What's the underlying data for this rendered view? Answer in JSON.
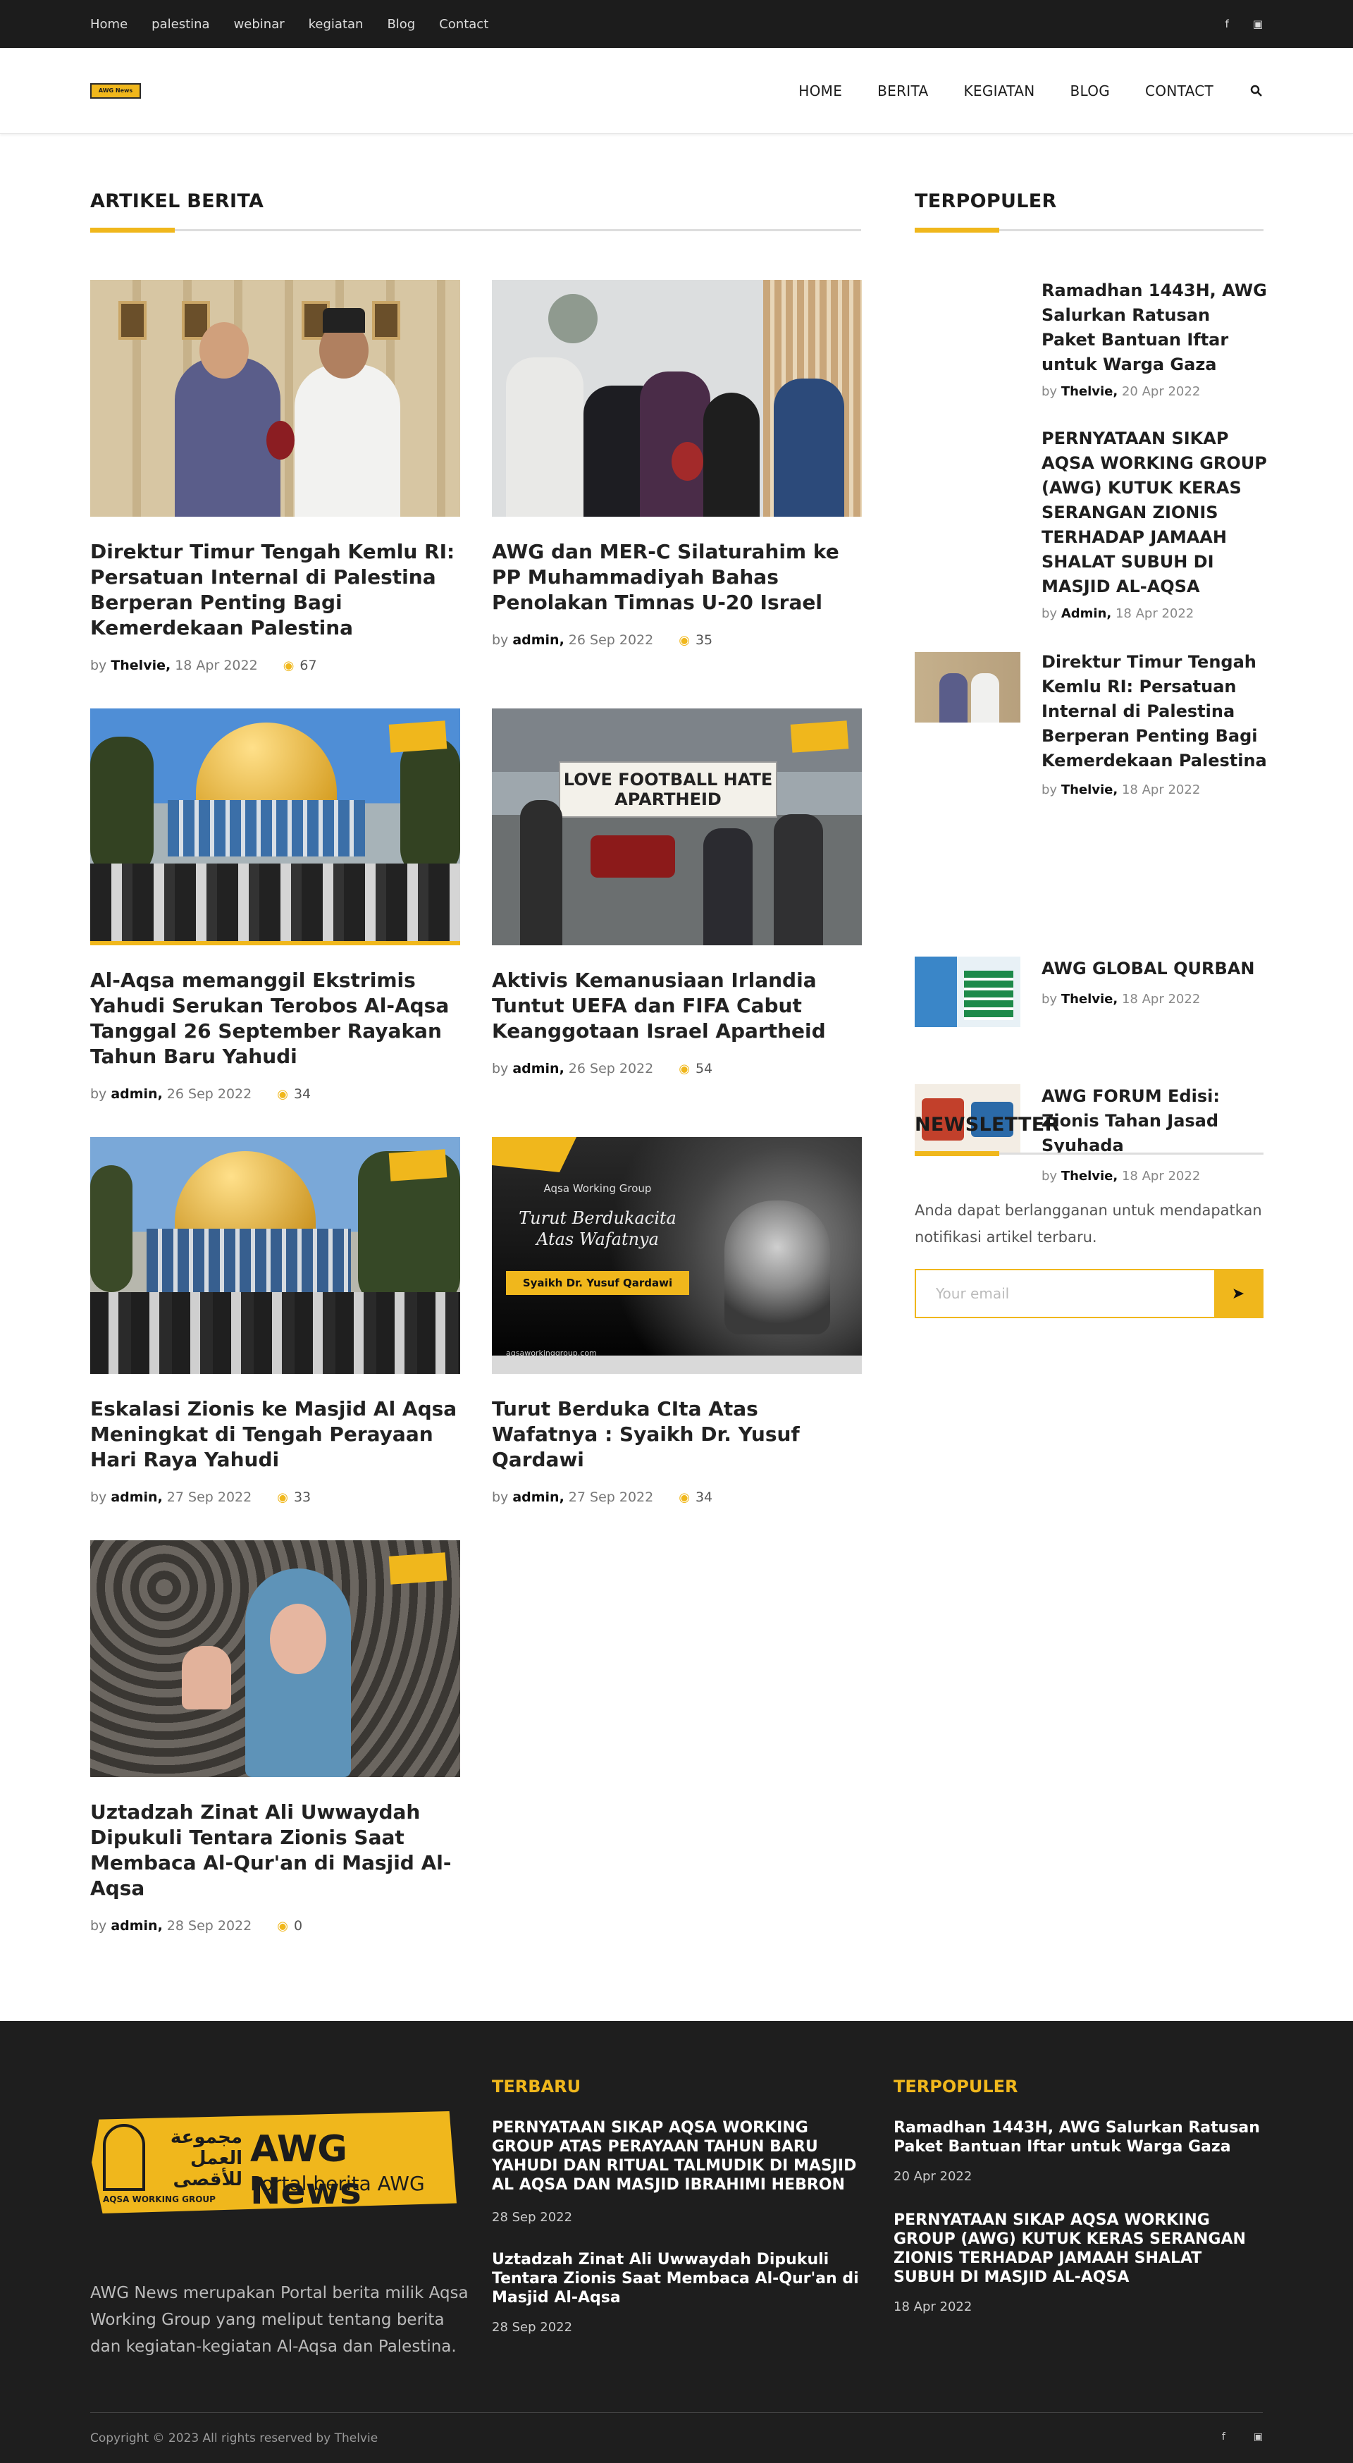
{
  "topbar": {
    "links": [
      "Home",
      "palestina",
      "webinar",
      "kegiatan",
      "Blog",
      "Contact"
    ],
    "social": [
      "facebook-icon",
      "instagram-icon"
    ]
  },
  "header": {
    "logo_text": "AWG News",
    "nav": [
      "HOME",
      "BERITA",
      "KEGIATAN",
      "BLOG",
      "CONTACT"
    ],
    "search_icon": "search-icon"
  },
  "main": {
    "title": "ARTIKEL BERITA",
    "by": "by",
    "articles": [
      {
        "title": "Direktur Timur Tengah Kemlu RI: Persatuan Internal di Palestina Berperan Penting Bagi Kemerdekaan Palestina",
        "author": "Thelvie,",
        "date": "18 Apr 2022",
        "views": "67"
      },
      {
        "title": "AWG dan MER-C Silaturahim ke PP Muhammadiyah Bahas Penolakan Timnas U-20 Israel",
        "author": "admin,",
        "date": "26 Sep 2022",
        "views": "35"
      },
      {
        "title": "Al-Aqsa memanggil Ekstrimis Yahudi Serukan Terobos Al-Aqsa Tanggal 26 September Rayakan Tahun Baru Yahudi",
        "author": "admin,",
        "date": "26 Sep 2022",
        "views": "34"
      },
      {
        "title": "Aktivis Kemanusiaan Irlandia Tuntut UEFA dan FIFA Cabut Keanggotaan Israel Apartheid",
        "author": "admin,",
        "date": "26 Sep 2022",
        "views": "54",
        "photo_text": "LOVE FOOTBALL HATE APARTHEID"
      },
      {
        "title": "Eskalasi Zionis ke Masjid Al Aqsa Meningkat di Tengah Perayaan Hari Raya Yahudi",
        "author": "admin,",
        "date": "27 Sep 2022",
        "views": "33"
      },
      {
        "title": "Turut Berduka CIta Atas Wafatnya : Syaikh Dr. Yusuf Qardawi",
        "author": "admin,",
        "date": "27 Sep 2022",
        "views": "34",
        "poster": {
          "org": "Aqsa Working Group",
          "headline": "Turut Berdukacita Atas Wafatnya",
          "name": "Syaikh Dr. Yusuf Qardawi",
          "site": "aqsaworkinggroup.com"
        }
      },
      {
        "title": "Uztadzah Zinat Ali Uwwaydah Dipukuli Tentara Zionis Saat Membaca Al-Qur'an di Masjid Al-Aqsa",
        "author": "admin,",
        "date": "28 Sep 2022",
        "views": "0"
      }
    ]
  },
  "sidebar": {
    "title": "TERPOPULER",
    "items": [
      {
        "title": "Ramadhan 1443H, AWG Salurkan Ratusan Paket Bantuan Iftar untuk Warga Gaza",
        "author": "Thelvie,",
        "date": "20 Apr 2022"
      },
      {
        "title": "PERNYATAAN SIKAP AQSA WORKING GROUP (AWG) KUTUK KERAS SERANGAN ZIONIS TERHADAP JAMAAH SHALAT SUBUH DI MASJID AL-AQSA",
        "author": "Admin,",
        "date": "18 Apr 2022"
      },
      {
        "title": "Direktur Timur Tengah Kemlu RI: Persatuan Internal di Palestina Berperan Penting Bagi Kemerdekaan Palestina",
        "author": "Thelvie,",
        "date": "18 Apr 2022"
      },
      {
        "title": "AWG GLOBAL QURBAN",
        "author": "Thelvie,",
        "date": "18 Apr 2022"
      },
      {
        "title": "AWG FORUM Edisi: Zionis Tahan Jasad Syuhada",
        "author": "Thelvie,",
        "date": "18 Apr 2022"
      }
    ],
    "newsletter": {
      "title": "NEWSLETTER",
      "text": "Anda dapat berlangganan untuk mendapatkan notifikasi artikel terbaru.",
      "placeholder": "Your email"
    }
  },
  "footer": {
    "logo": {
      "arabic": "مجموعة العمل للأقصى",
      "name": "AWG News",
      "tagline": "Portal berita AWG",
      "org": "AQSA WORKING GROUP"
    },
    "description": "AWG News merupakan Portal berita milik Aqsa Working Group yang meliput tentang berita dan kegiatan-kegiatan Al-Aqsa dan Palestina.",
    "latest_title": "TERBARU",
    "latest": [
      {
        "title": "PERNYATAAN SIKAP AQSA WORKING GROUP ATAS PERAYAAN TAHUN BARU YAHUDI DAN RITUAL TALMUDIK DI MASJID AL AQSA DAN MASJID IBRAHIMI HEBRON",
        "date": "28 Sep 2022"
      },
      {
        "title": "Uztadzah Zinat Ali Uwwaydah Dipukuli Tentara Zionis Saat Membaca Al-Qur'an di Masjid Al-Aqsa",
        "date": "28 Sep 2022"
      }
    ],
    "popular_title": "TERPOPULER",
    "popular": [
      {
        "title": "Ramadhan 1443H, AWG Salurkan Ratusan Paket Bantuan Iftar untuk Warga Gaza",
        "date": "20 Apr 2022"
      },
      {
        "title": "PERNYATAAN SIKAP AQSA WORKING GROUP (AWG) KUTUK KERAS SERANGAN ZIONIS TERHADAP JAMAAH SHALAT SUBUH DI MASJID AL-AQSA",
        "date": "18 Apr 2022"
      }
    ],
    "copyright": "Copyright © 2023 All rights reserved by  Thelvie"
  },
  "colors": {
    "accent": "#f0b71c",
    "dark": "#1c1c1c"
  }
}
